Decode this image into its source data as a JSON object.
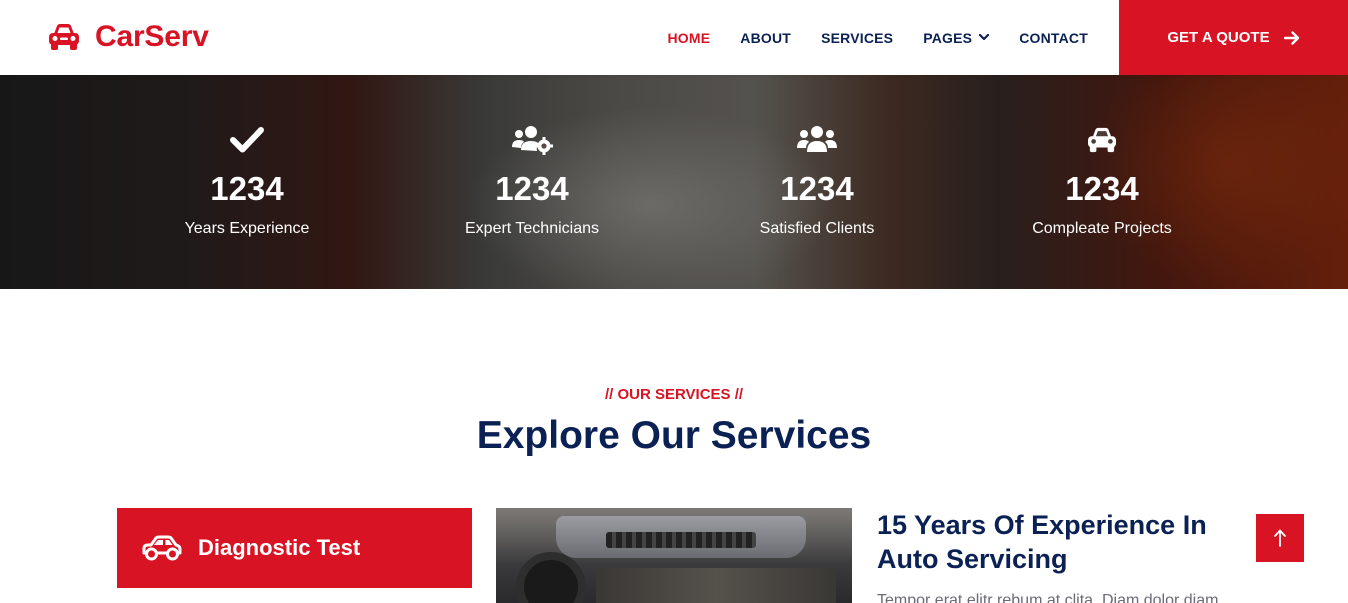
{
  "navbar": {
    "brand": "CarServ",
    "brand_icon": "car-icon",
    "links": [
      {
        "label": "HOME",
        "active": true
      },
      {
        "label": "ABOUT",
        "active": false
      },
      {
        "label": "SERVICES",
        "active": false
      },
      {
        "label": "PAGES",
        "active": false,
        "dropdown": true
      },
      {
        "label": "CONTACT",
        "active": false
      }
    ],
    "cta": "GET A QUOTE",
    "cta_icon": "arrow-right-icon"
  },
  "facts": [
    {
      "icon": "check-icon",
      "number": "1234",
      "label": "Years Experience"
    },
    {
      "icon": "users-cog-icon",
      "number": "1234",
      "label": "Expert Technicians"
    },
    {
      "icon": "users-icon",
      "number": "1234",
      "label": "Satisfied Clients"
    },
    {
      "icon": "car-icon",
      "number": "1234",
      "label": "Compleate Projects"
    }
  ],
  "services": {
    "subtitle": "// OUR SERVICES //",
    "title": "Explore Our Services",
    "active_tab": {
      "icon": "car-side-icon",
      "label": "Diagnostic Test"
    },
    "detail_title": "15 Years Of Experience In Auto Servicing",
    "detail_text": "Tempor erat elitr rebum at clita. Diam dolor diam"
  },
  "back_to_top_icon": "arrow-up-icon",
  "colors": {
    "primary": "#D81324",
    "dark": "#0B2154",
    "white": "#FFFFFF"
  }
}
